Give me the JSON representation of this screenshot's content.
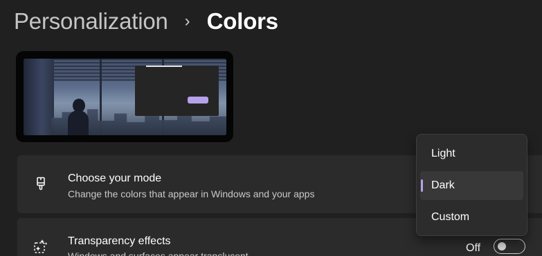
{
  "breadcrumb": {
    "parent": "Personalization",
    "separator": "›",
    "current": "Colors"
  },
  "colors": {
    "accent": "#b5a2ea",
    "background": "#202020",
    "card": "#2b2b2b"
  },
  "cards": {
    "mode": {
      "icon": "paintbrush-icon",
      "title": "Choose your mode",
      "description": "Change the colors that appear in Windows and your apps"
    },
    "transparency": {
      "icon": "transparency-icon",
      "title": "Transparency effects",
      "description": "Windows and surfaces appear translucent",
      "state_label": "Off",
      "toggle_on": false
    }
  },
  "mode_menu": {
    "options": [
      "Light",
      "Dark",
      "Custom"
    ],
    "selected": "Dark"
  }
}
